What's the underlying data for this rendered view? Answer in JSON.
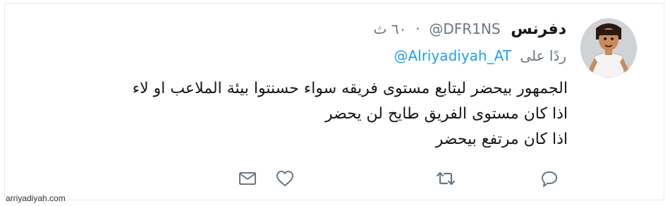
{
  "tweet": {
    "display_name": "دفرنس",
    "handle": "@DFR1NS",
    "time": "٦٠ ث",
    "reply_prefix": "ردًا على",
    "reply_to": "@Alriyadiyah_AT",
    "lines": [
      "الجمهور بيحضر ليتابع مستوى فريقه سواء حسنتوا بيئة الملاعب او لاء",
      "اذا كان مستوى الفريق طايح لن يحضر",
      "اذا كان مرتفع بيحضر"
    ]
  },
  "actions": {
    "icons": [
      "reply-icon",
      "retweet-icon",
      "like-icon",
      "message-icon"
    ]
  },
  "watermark": "arriyadiyah.com",
  "colors": {
    "text": "#14171a",
    "muted": "#657786",
    "link": "#1da1f2",
    "border": "#e6ecf0"
  }
}
